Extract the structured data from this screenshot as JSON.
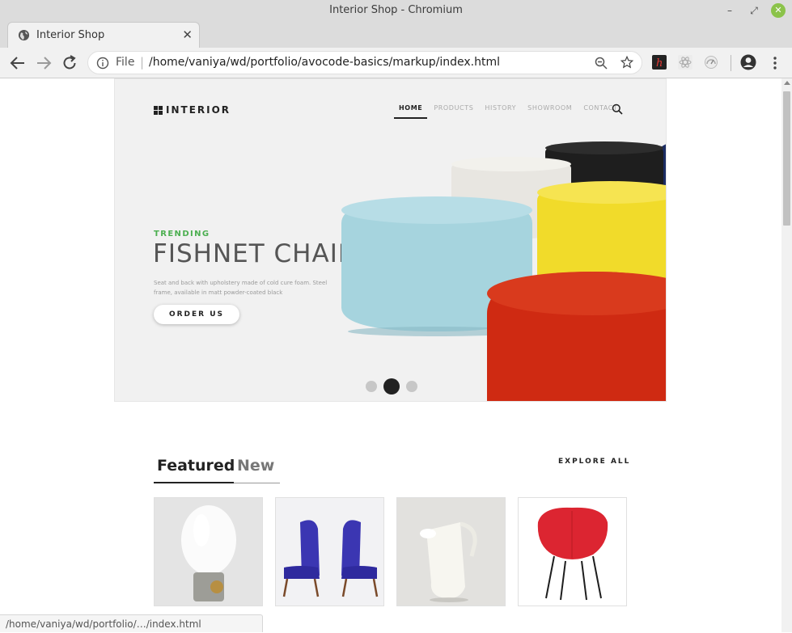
{
  "window": {
    "title": "Interior Shop - Chromium",
    "minimize_icon": "minimize-icon",
    "maximize_icon": "maximize-icon",
    "close_icon": "close-icon"
  },
  "tabs": [
    {
      "label": "Interior Shop",
      "icon": "globe-icon",
      "active": true
    }
  ],
  "toolbar": {
    "scheme": "File",
    "url": "/home/vaniya/wd/portfolio/avocode-basics/markup/index.html",
    "separator": "|"
  },
  "site": {
    "logo": "INTERIOR",
    "nav": [
      {
        "label": "HOME",
        "active": true
      },
      {
        "label": "PRODUCTS",
        "active": false
      },
      {
        "label": "HISTORY",
        "active": false
      },
      {
        "label": "SHOWROOM",
        "active": false
      },
      {
        "label": "CONTACT",
        "active": false
      }
    ],
    "hero": {
      "eyebrow": "TRENDING",
      "title": "FISHNET CHAIR",
      "description": "Seat and back with upholstery made of cold cure foam. Steel frame, available in matt powder-coated black",
      "cta": "ORDER US",
      "slides": 3,
      "active_slide": 2,
      "colors": {
        "accent": "#4caf50",
        "blue": "#a6d4de",
        "yellow": "#f1db2a",
        "red": "#cf2a12",
        "white": "#e8e6e1",
        "black": "#1e1e1e",
        "navy": "#1b2c63"
      }
    },
    "featured": {
      "tabs": [
        {
          "label": "Featured",
          "active": true
        },
        {
          "label": "New",
          "active": false
        }
      ],
      "explore": "EXPLORE ALL",
      "products": [
        {
          "name": "lamp"
        },
        {
          "name": "blue-chairs"
        },
        {
          "name": "jug"
        },
        {
          "name": "red-chair"
        }
      ]
    }
  },
  "statusbar": {
    "text": "/home/vaniya/wd/portfolio/…/index.html"
  }
}
